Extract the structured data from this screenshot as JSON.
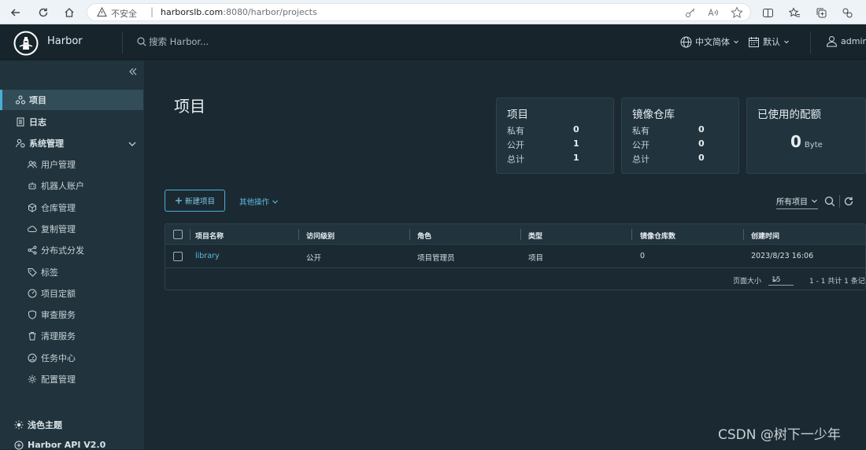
{
  "browser": {
    "insecure_label": "不安全",
    "separator": "|",
    "url_host": "harborslb.com",
    "url_rest": ":8080/harbor/projects"
  },
  "header": {
    "brand": "Harbor",
    "search_placeholder": "搜索 Harbor...",
    "language": "中文简体",
    "theme_default": "默认",
    "user": "admin"
  },
  "sidebar": {
    "items": [
      {
        "label": "项目",
        "icon": "projects-icon"
      },
      {
        "label": "日志",
        "icon": "logs-icon"
      },
      {
        "label": "系统管理",
        "icon": "admin-icon"
      },
      {
        "label": "用户管理",
        "icon": "users-icon"
      },
      {
        "label": "机器人账户",
        "icon": "robot-icon"
      },
      {
        "label": "仓库管理",
        "icon": "registry-icon"
      },
      {
        "label": "复制管理",
        "icon": "replication-icon"
      },
      {
        "label": "分布式分发",
        "icon": "distribution-icon"
      },
      {
        "label": "标签",
        "icon": "tag-icon"
      },
      {
        "label": "项目定额",
        "icon": "quota-icon"
      },
      {
        "label": "审查服务",
        "icon": "shield-icon"
      },
      {
        "label": "清理服务",
        "icon": "trash-icon"
      },
      {
        "label": "任务中心",
        "icon": "dashboard-icon"
      },
      {
        "label": "配置管理",
        "icon": "gear-icon"
      }
    ],
    "light_theme": "浅色主题",
    "api": "Harbor API V2.0"
  },
  "main": {
    "title": "项目",
    "cards": {
      "projects": {
        "title": "项目",
        "rows": [
          {
            "label": "私有",
            "value": "0"
          },
          {
            "label": "公开",
            "value": "1"
          },
          {
            "label": "总计",
            "value": "1"
          }
        ]
      },
      "repos": {
        "title": "镜像仓库",
        "rows": [
          {
            "label": "私有",
            "value": "0"
          },
          {
            "label": "公开",
            "value": "0"
          },
          {
            "label": "总计",
            "value": "0"
          }
        ]
      },
      "quota": {
        "title": "已使用的配额",
        "value": "0",
        "unit": "Byte"
      }
    },
    "new_project": "新建项目",
    "more_actions": "其他操作",
    "filter": "所有项目",
    "table": {
      "headers": [
        "项目名称",
        "访问级别",
        "角色",
        "类型",
        "镜像仓库数",
        "创建时间"
      ],
      "rows": [
        {
          "name": "library",
          "access": "公开",
          "role": "项目管理员",
          "type": "项目",
          "repos": "0",
          "created": "2023/8/23 16:06"
        }
      ],
      "page_size_label": "页面大小",
      "page_size": "15",
      "summary": "1 - 1 共计 1 条记录"
    }
  },
  "watermark": "CSDN @树下一少年",
  "colors": {
    "accent": "#49afd9",
    "background": "#1b2a32",
    "sidebar": "#21333c",
    "header": "#17242b"
  }
}
